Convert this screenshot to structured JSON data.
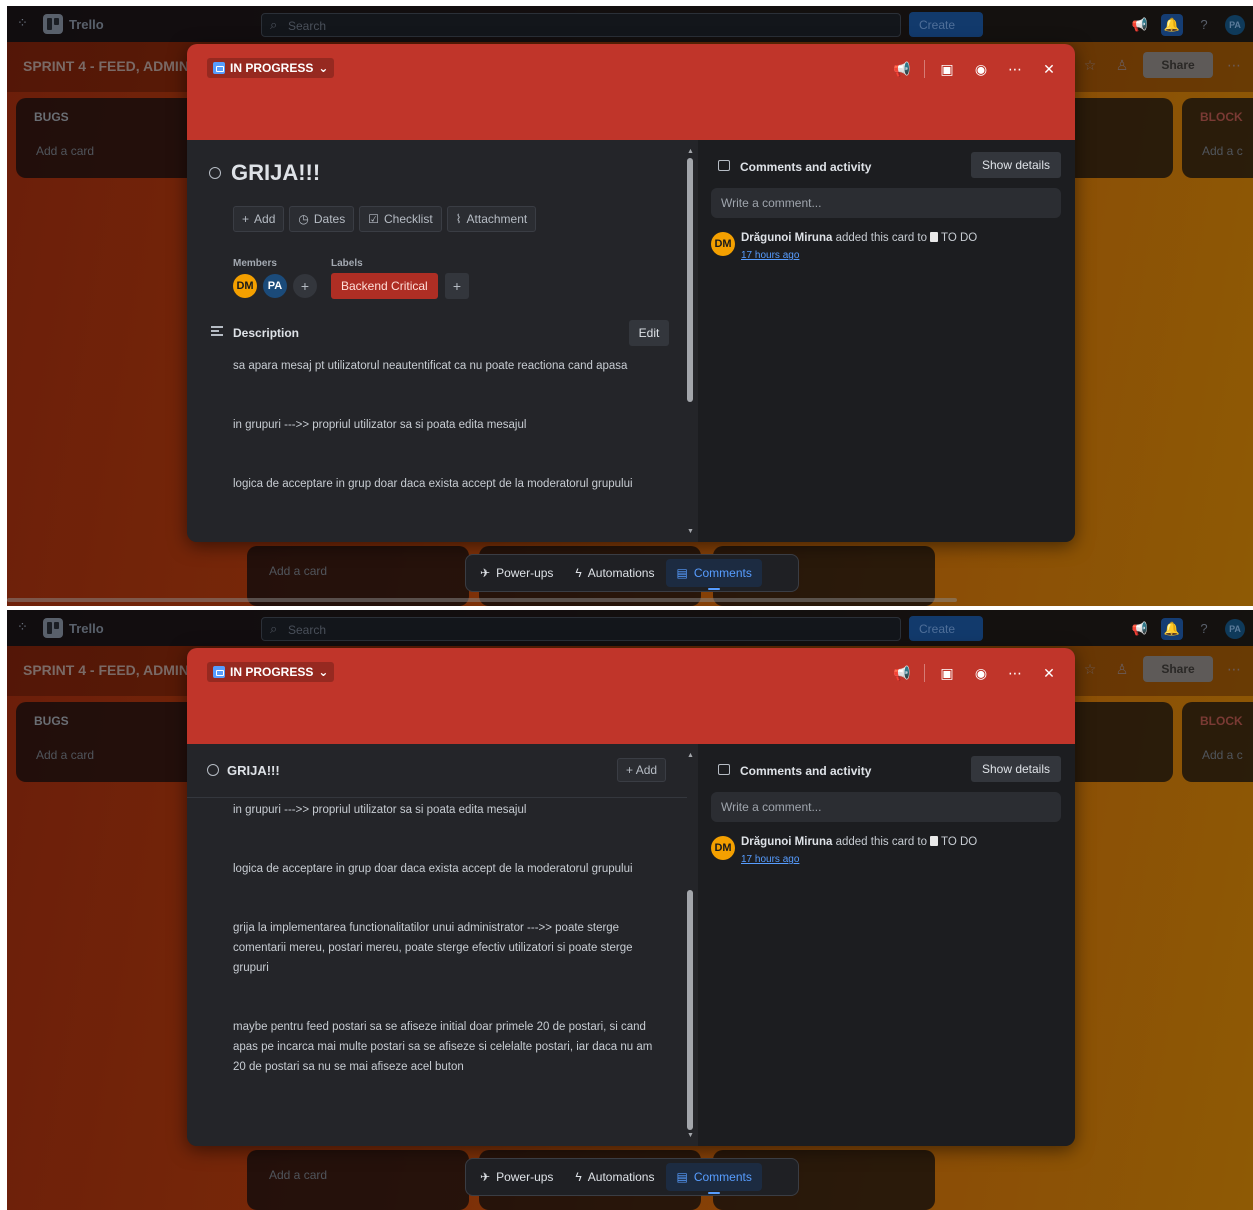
{
  "app": {
    "name": "Trello",
    "search_placeholder": "Search",
    "create_label": "Create",
    "user_initials": "PA"
  },
  "board": {
    "title": "SPRINT 4 - FEED, ADMIN, ...",
    "share_label": "Share",
    "lists": {
      "bugs": "BUGS",
      "blocked": "BLOCK",
      "add_card": "Add a card",
      "add_card_short": "Add a c"
    }
  },
  "card": {
    "status": "IN PROGRESS",
    "title": "GRIJA!!!",
    "actions": {
      "add": "Add",
      "dates": "Dates",
      "checklist": "Checklist",
      "attachment": "Attachment"
    },
    "members_label": "Members",
    "labels_label": "Labels",
    "members": [
      "DM",
      "PA"
    ],
    "label": {
      "name": "Backend Critical",
      "color": "#ae2e24"
    },
    "description_title": "Description",
    "edit_label": "Edit",
    "description": [
      "sa apara mesaj pt utilizatorul neautentificat ca nu poate reactiona cand apasa",
      "in grupuri --->> propriul utilizator sa si poata edita mesajul",
      "logica de acceptare in grup doar daca exista accept de la moderatorul grupului",
      "grija la implementarea functionalitatilor unui administrator --->> poate sterge comentarii mereu, postari mereu, poate sterge efectiv utilizatori si poate sterge grupuri",
      "maybe pentru feed postari sa se afiseze initial doar primele 20 de postari, si cand apas pe incarca mai multe postari sa se afiseze si celelalte postari, iar daca nu am 20 de postari sa nu se mai afiseze acel buton"
    ]
  },
  "activity": {
    "title": "Comments and activity",
    "show_details": "Show details",
    "comment_placeholder": "Write a comment...",
    "entry": {
      "avatar": "DM",
      "user": "Drăgunoi Miruna",
      "action": "added this card to",
      "list": "TO DO",
      "time": "17 hours ago"
    }
  },
  "bottom_bar": {
    "powerups": "Power-ups",
    "automations": "Automations",
    "comments": "Comments"
  },
  "colors": {
    "cover": "#c0352a",
    "accent": "#579dff",
    "avatar_dm": "#f4a000"
  }
}
